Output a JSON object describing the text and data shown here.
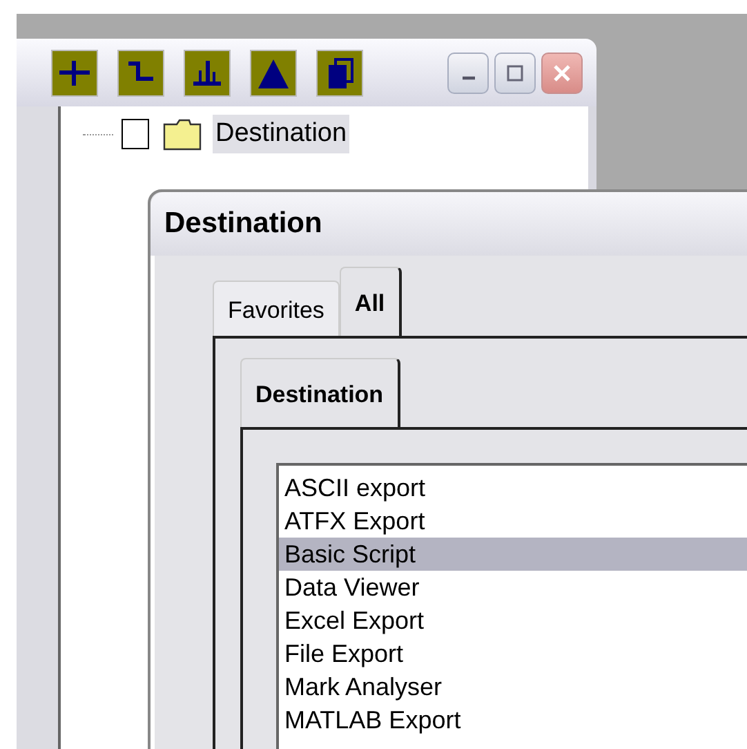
{
  "back_window": {
    "toolbar": [
      {
        "kind": "crosshair"
      },
      {
        "kind": "step"
      },
      {
        "kind": "peaks"
      },
      {
        "kind": "peak"
      },
      {
        "kind": "pages"
      }
    ],
    "tree": [
      {
        "label": "Destination",
        "checked": false,
        "selected": true
      }
    ]
  },
  "dialog": {
    "title": "Destination",
    "tabs": [
      {
        "label": "Favorites",
        "selected": false
      },
      {
        "label": "All",
        "selected": true
      }
    ],
    "inner_tabs": [
      {
        "label": "Destination",
        "selected": true
      }
    ],
    "items": [
      {
        "label": "ASCII export",
        "selected": false
      },
      {
        "label": "ATFX Export",
        "selected": false
      },
      {
        "label": "Basic Script",
        "selected": true
      },
      {
        "label": "Data Viewer",
        "selected": false
      },
      {
        "label": "Excel Export",
        "selected": false
      },
      {
        "label": "File Export",
        "selected": false
      },
      {
        "label": "Mark Analyser",
        "selected": false
      },
      {
        "label": "MATLAB Export",
        "selected": false
      }
    ]
  }
}
